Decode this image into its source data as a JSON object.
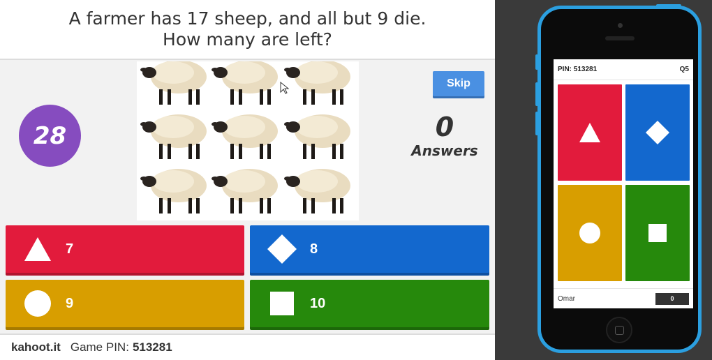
{
  "question": {
    "line1": "A farmer has 17 sheep, and all but 9 die.",
    "line2": "How many are left?"
  },
  "timer": {
    "value": "28"
  },
  "skip": {
    "label": "Skip"
  },
  "answers_count": {
    "value": "0",
    "label": "Answers"
  },
  "answers": [
    {
      "shape": "triangle-icon",
      "label": "7",
      "color": "#e21b3c"
    },
    {
      "shape": "diamond-icon",
      "label": "8",
      "color": "#1368ce"
    },
    {
      "shape": "circle-icon",
      "label": "9",
      "color": "#d89e00"
    },
    {
      "shape": "square-icon",
      "label": "10",
      "color": "#26890c"
    }
  ],
  "footer": {
    "brand": "kahoot.it",
    "pin_label": "Game PIN:",
    "pin_value": "513281"
  },
  "phone": {
    "pin": "PIN: 513281",
    "question_number": "Q5",
    "player_name": "Omar",
    "score": "0",
    "frame_color": "#2b9fe0"
  }
}
